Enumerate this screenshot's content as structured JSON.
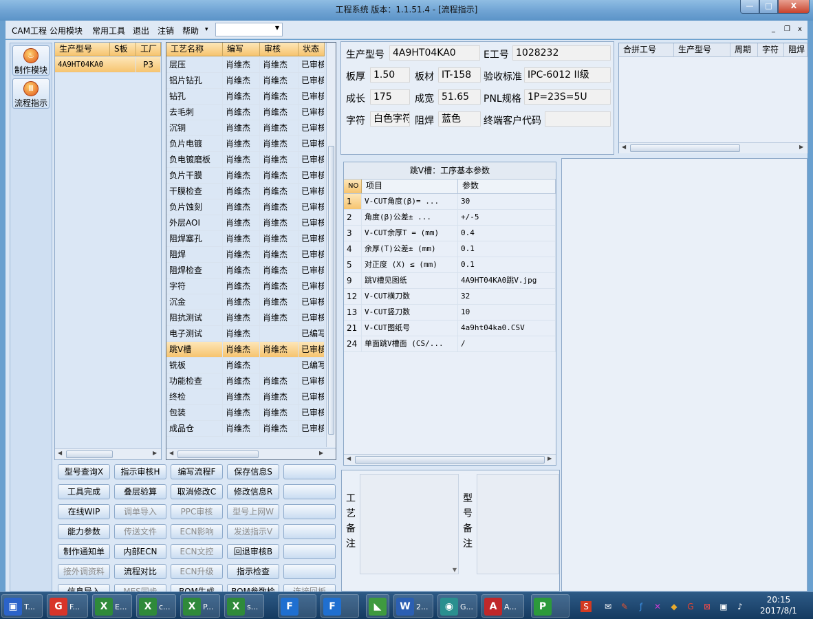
{
  "window": {
    "title": "工程系统   版本：1.1.51.4 - [流程指示]",
    "min": "—",
    "max": "□",
    "close": "X"
  },
  "menu": {
    "items": [
      "CAM工程",
      "公用模块",
      "常用工具",
      "退出",
      "注销",
      "帮助"
    ],
    "combo_value": "",
    "mdi_min": "_",
    "mdi_restore": "❐",
    "mdi_close": "x"
  },
  "modules": [
    {
      "label": "制作模块",
      "icon": "flame"
    },
    {
      "label": "流程指示",
      "icon": "flow"
    }
  ],
  "model_list": {
    "headers": [
      "生产型号",
      "S板",
      "工厂"
    ],
    "rows": [
      {
        "model": "4A9HT04KA0",
        "s": "",
        "factory": "P3"
      }
    ]
  },
  "process_list": {
    "headers": [
      "工艺名称",
      "编写",
      "审核",
      "状态"
    ],
    "rows": [
      {
        "name": "层压",
        "writer": "肖维杰",
        "reviewer": "肖维杰",
        "status": "已审核"
      },
      {
        "name": "铝片钻孔",
        "writer": "肖维杰",
        "reviewer": "肖维杰",
        "status": "已审核"
      },
      {
        "name": "钻孔",
        "writer": "肖维杰",
        "reviewer": "肖维杰",
        "status": "已审核"
      },
      {
        "name": "去毛刺",
        "writer": "肖维杰",
        "reviewer": "肖维杰",
        "status": "已审核"
      },
      {
        "name": "沉铜",
        "writer": "肖维杰",
        "reviewer": "肖维杰",
        "status": "已审核"
      },
      {
        "name": "负片电镀",
        "writer": "肖维杰",
        "reviewer": "肖维杰",
        "status": "已审核"
      },
      {
        "name": "负电镀磨板",
        "writer": "肖维杰",
        "reviewer": "肖维杰",
        "status": "已审核"
      },
      {
        "name": "负片干膜",
        "writer": "肖维杰",
        "reviewer": "肖维杰",
        "status": "已审核"
      },
      {
        "name": "干膜检查",
        "writer": "肖维杰",
        "reviewer": "肖维杰",
        "status": "已审核"
      },
      {
        "name": "负片蚀刻",
        "writer": "肖维杰",
        "reviewer": "肖维杰",
        "status": "已审核"
      },
      {
        "name": "外层AOI",
        "writer": "肖维杰",
        "reviewer": "肖维杰",
        "status": "已审核"
      },
      {
        "name": "阻焊塞孔",
        "writer": "肖维杰",
        "reviewer": "肖维杰",
        "status": "已审核"
      },
      {
        "name": "阻焊",
        "writer": "肖维杰",
        "reviewer": "肖维杰",
        "status": "已审核"
      },
      {
        "name": "阻焊检查",
        "writer": "肖维杰",
        "reviewer": "肖维杰",
        "status": "已审核"
      },
      {
        "name": "字符",
        "writer": "肖维杰",
        "reviewer": "肖维杰",
        "status": "已审核"
      },
      {
        "name": "沉金",
        "writer": "肖维杰",
        "reviewer": "肖维杰",
        "status": "已审核"
      },
      {
        "name": "阻抗测试",
        "writer": "肖维杰",
        "reviewer": "肖维杰",
        "status": "已审核"
      },
      {
        "name": "电子测试",
        "writer": "肖维杰",
        "reviewer": "",
        "status": "已编写"
      },
      {
        "name": "跳V槽",
        "writer": "肖维杰",
        "reviewer": "肖维杰",
        "status": "已审核"
      },
      {
        "name": "铣板",
        "writer": "肖维杰",
        "reviewer": "",
        "status": "已编写"
      },
      {
        "name": "功能检查",
        "writer": "肖维杰",
        "reviewer": "肖维杰",
        "status": "已审核"
      },
      {
        "name": "终检",
        "writer": "肖维杰",
        "reviewer": "肖维杰",
        "status": "已审核"
      },
      {
        "name": "包装",
        "writer": "肖维杰",
        "reviewer": "肖维杰",
        "status": "已审核"
      },
      {
        "name": "成品仓",
        "writer": "肖维杰",
        "reviewer": "肖维杰",
        "status": "已审核"
      }
    ]
  },
  "buttons": [
    [
      {
        "label": "型号查询X",
        "disabled": false
      },
      {
        "label": "指示审核H",
        "disabled": false
      },
      {
        "label": "编写流程F",
        "disabled": false
      },
      {
        "label": "保存信息S",
        "disabled": false
      },
      {
        "label": "",
        "disabled": false
      }
    ],
    [
      {
        "label": "工具完成",
        "disabled": false
      },
      {
        "label": "叠层验算",
        "disabled": false
      },
      {
        "label": "取消修改C",
        "disabled": false
      },
      {
        "label": "修改信息R",
        "disabled": false
      },
      {
        "label": "",
        "disabled": false
      }
    ],
    [
      {
        "label": "在线WIP",
        "disabled": false
      },
      {
        "label": "调单导入",
        "disabled": true
      },
      {
        "label": "PPC审核",
        "disabled": true
      },
      {
        "label": "型号上网W",
        "disabled": true
      },
      {
        "label": "",
        "disabled": false
      }
    ],
    [
      {
        "label": "能力参数",
        "disabled": false
      },
      {
        "label": "传送文件",
        "disabled": true
      },
      {
        "label": "ECN影响",
        "disabled": true
      },
      {
        "label": "发送指示V",
        "disabled": true
      },
      {
        "label": "",
        "disabled": false
      }
    ],
    [
      {
        "label": "制作通知单",
        "disabled": false
      },
      {
        "label": "内部ECN",
        "disabled": false
      },
      {
        "label": "ECN文控",
        "disabled": true
      },
      {
        "label": "回退审核B",
        "disabled": false
      },
      {
        "label": "",
        "disabled": false
      }
    ],
    [
      {
        "label": "接外调资料",
        "disabled": true
      },
      {
        "label": "流程对比",
        "disabled": false
      },
      {
        "label": "ECN升级",
        "disabled": true
      },
      {
        "label": "指示检查",
        "disabled": false
      },
      {
        "label": "",
        "disabled": false
      }
    ],
    [
      {
        "label": "信息导入",
        "disabled": false
      },
      {
        "label": "MES同步",
        "disabled": true
      },
      {
        "label": "BOM生成",
        "disabled": false
      },
      {
        "label": "BOM参数检查",
        "disabled": false
      },
      {
        "label": "连接回板",
        "disabled": true
      }
    ]
  ],
  "info": {
    "model_label": "生产型号",
    "model": "4A9HT04KA0",
    "eno_label": "E工号",
    "eno": "1028232",
    "thick_label": "板厚",
    "thick": "1.50",
    "material_label": "板材",
    "material": "IT-158",
    "standard_label": "验收标准",
    "standard": "IPC-6012 II级",
    "length_label": "成长",
    "length": "175",
    "width_label": "成宽",
    "width": "51.65",
    "pnl_label": "PNL规格",
    "pnl": "1P=23S=5U",
    "char_label": "字符",
    "char": "白色字符",
    "mask_label": "阻焊",
    "mask": "蓝色",
    "customer_label": "终端客户代码",
    "customer": ""
  },
  "merge_grid": {
    "headers": [
      "合拼工号",
      "生产型号",
      "周期",
      "字符",
      "阻焊"
    ]
  },
  "params": {
    "title": "跳V槽：工序基本参数",
    "headers": [
      "NO",
      "项目",
      "参数"
    ],
    "rows": [
      {
        "no": "1",
        "item": "V-CUT角度(β)=  ...",
        "value": "30"
      },
      {
        "no": "2",
        "item": "角度(β)公差±  ...",
        "value": "+/-5"
      },
      {
        "no": "3",
        "item": "V-CUT余厚T =  (mm)",
        "value": "0.4"
      },
      {
        "no": "4",
        "item": "余厚(T)公差±  (mm)",
        "value": "0.1"
      },
      {
        "no": "5",
        "item": "对正度 (X) ≤ (mm)",
        "value": "0.1"
      },
      {
        "no": "9",
        "item": "跳V槽见图纸",
        "value": "4A9HT04KA0跳V.jpg"
      },
      {
        "no": "12",
        "item": "V-CUT横刀数",
        "value": "32"
      },
      {
        "no": "13",
        "item": "V-CUT竖刀数",
        "value": "10"
      },
      {
        "no": "21",
        "item": "V-CUT图纸号",
        "value": "4a9ht04ka0.CSV"
      },
      {
        "no": "24",
        "item": "单面跳V槽面 (CS/...",
        "value": "/"
      }
    ]
  },
  "notes": {
    "process_note_label": "工艺备注",
    "model_note_label": "型号备注"
  },
  "taskbar": {
    "items": [
      {
        "label": "T...",
        "icon": "save-icon",
        "color": "#2b63c9"
      },
      {
        "label": "F...",
        "icon": "g-icon",
        "color": "#d8352a"
      },
      {
        "label": "E...",
        "icon": "excel-icon",
        "color": "#2f8a3a"
      },
      {
        "label": "c...",
        "icon": "excel-icon",
        "color": "#2f8a3a"
      },
      {
        "label": "P...",
        "icon": "excel-icon",
        "color": "#2f8a3a"
      },
      {
        "label": "s...",
        "icon": "excel-icon",
        "color": "#2f8a3a"
      },
      {
        "label": "",
        "icon": "f-icon",
        "color": "#1f6fd0"
      },
      {
        "label": "",
        "icon": "f-icon",
        "color": "#1f6fd0"
      },
      {
        "label": "",
        "icon": "shape-icon",
        "color": "#3f9a3f"
      },
      {
        "label": "2...",
        "icon": "word-icon",
        "color": "#2b5fb3"
      },
      {
        "label": "G...",
        "icon": "eye-icon",
        "color": "#2a8f8f"
      },
      {
        "label": "A...",
        "icon": "pdf-icon",
        "color": "#c0282a"
      },
      {
        "label": "",
        "icon": "p-icon",
        "color": "#2c9a3b"
      }
    ],
    "time": "20:15",
    "date": "2017/8/1"
  }
}
